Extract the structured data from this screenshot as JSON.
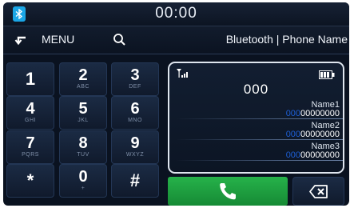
{
  "status_bar": {
    "time": "00:00",
    "bluetooth_icon": "bluetooth-icon"
  },
  "toolbar": {
    "back_icon": "back-arrow-icon",
    "menu_label": "MENU",
    "search_icon": "search-icon",
    "title": "Bluetooth | Phone Name"
  },
  "keypad": {
    "keys": [
      {
        "digit": "1",
        "letters": ""
      },
      {
        "digit": "2",
        "letters": "ABC"
      },
      {
        "digit": "3",
        "letters": "DEF"
      },
      {
        "digit": "4",
        "letters": "GHI"
      },
      {
        "digit": "5",
        "letters": "JKL"
      },
      {
        "digit": "6",
        "letters": "MNO"
      },
      {
        "digit": "7",
        "letters": "PQRS"
      },
      {
        "digit": "8",
        "letters": "TUV"
      },
      {
        "digit": "9",
        "letters": "WXYZ"
      },
      {
        "digit": "*",
        "letters": ""
      },
      {
        "digit": "0",
        "letters": "+"
      },
      {
        "digit": "#",
        "letters": ""
      }
    ]
  },
  "dialer": {
    "signal_icon": "signal-strength-icon",
    "battery_icon": "battery-icon",
    "number": "000",
    "contacts": [
      {
        "name": "Name1",
        "match": "000",
        "rest": "00000000"
      },
      {
        "name": "Name2",
        "match": "000",
        "rest": "00000000"
      },
      {
        "name": "Name3",
        "match": "000",
        "rest": "00000000"
      }
    ]
  },
  "actions": {
    "call_icon": "phone-call-icon",
    "delete_icon": "backspace-icon"
  },
  "colors": {
    "call_green": "#1fa043",
    "match_blue": "#1d5fd6",
    "background": "#0a1220"
  }
}
